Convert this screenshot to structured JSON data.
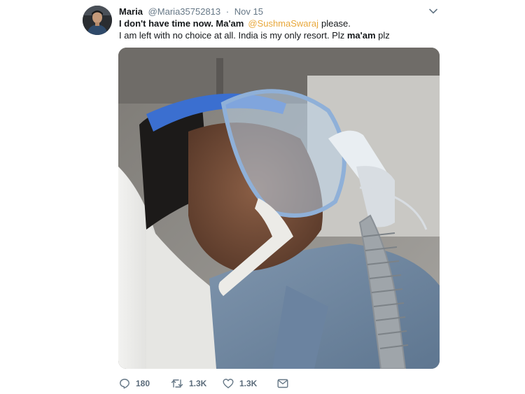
{
  "tweet": {
    "display_name": "Maria",
    "handle": "@Maria35752813",
    "separator": "·",
    "date": "Nov 15",
    "line1_bold": "I don't have time now. Ma'am",
    "mention": "@SushmaSwaraj",
    "line1_tail": "please.",
    "line2_start": "I am left with no choice at all. India is my only resort. Plz",
    "line2_bold": "ma'am",
    "line2_end": "plz"
  },
  "actions": {
    "reply_count": "180",
    "retweet_count": "1.3K",
    "like_count": "1.3K"
  },
  "icons": {
    "caret": "chevron-down-icon",
    "reply": "reply-icon",
    "retweet": "retweet-icon",
    "like": "heart-icon",
    "message": "envelope-icon"
  },
  "colors": {
    "mention": "#e8a73a",
    "muted": "#657786",
    "text": "#14171a"
  }
}
